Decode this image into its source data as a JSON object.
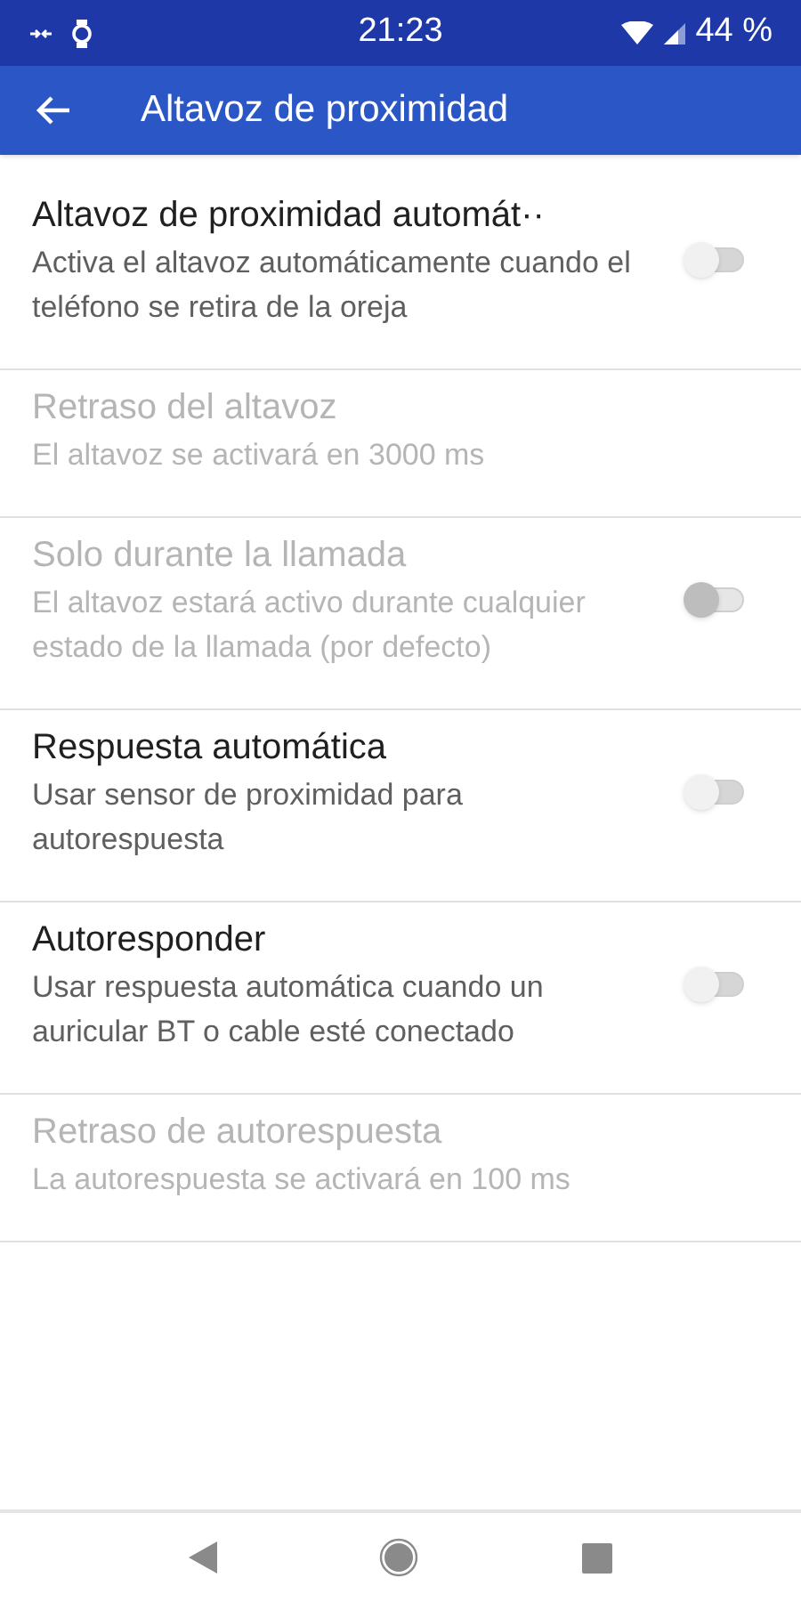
{
  "status_bar": {
    "time": "21:23",
    "battery": "44 %"
  },
  "app_bar": {
    "title": "Altavoz de proximidad"
  },
  "settings": [
    {
      "kind": "switch",
      "title": "Altavoz de proximidad automát··",
      "summary": "Activa el altavoz automáticamente cuando el teléfono se retira de la oreja",
      "disabled": false,
      "on": false
    },
    {
      "kind": "text",
      "title": "Retraso del altavoz",
      "summary": "El altavoz se activará en 3000 ms",
      "disabled": true
    },
    {
      "kind": "switch",
      "title": "Solo durante la llamada",
      "summary": "El altavoz estará activo durante cualquier estado de la llamada (por defecto)",
      "disabled": true,
      "on": false
    },
    {
      "kind": "switch",
      "title": "Respuesta automática",
      "summary": "Usar sensor de proximidad para autorespuesta",
      "disabled": false,
      "on": false
    },
    {
      "kind": "switch",
      "title": "Autoresponder",
      "summary": "Usar respuesta automática cuando un auricular BT o cable esté conectado",
      "disabled": false,
      "on": false
    },
    {
      "kind": "text",
      "title": "Retraso de autorespuesta",
      "summary": "La autorespuesta se activará en 100 ms",
      "disabled": true
    }
  ]
}
